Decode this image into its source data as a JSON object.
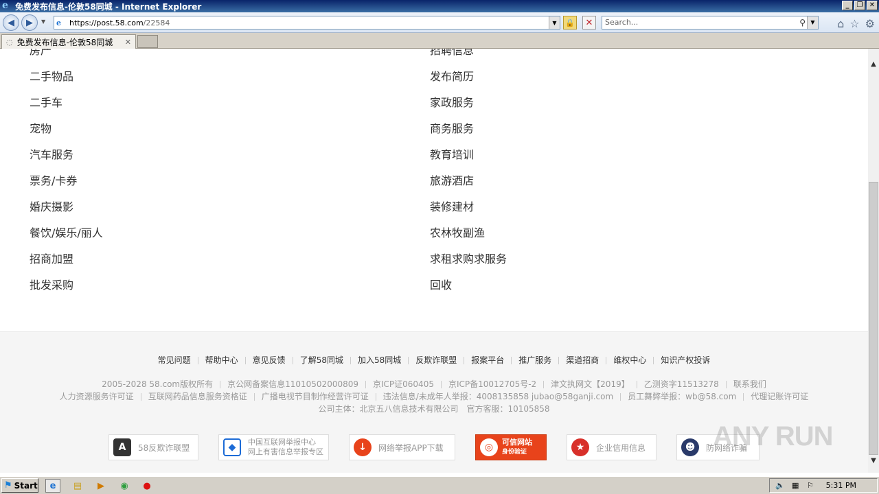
{
  "window": {
    "title": "免费发布信息-伦敦58同城 - Internet Explorer"
  },
  "address_bar": {
    "url_host": "https://post.58.com",
    "url_path": "/22584"
  },
  "search": {
    "placeholder": "Search..."
  },
  "tab": {
    "label": "免费发布信息-伦敦58同城"
  },
  "categories_left": [
    {
      "label": "房产"
    },
    {
      "label": "二手物品"
    },
    {
      "label": "二手车"
    },
    {
      "label": "宠物"
    },
    {
      "label": "汽车服务"
    },
    {
      "label": "票务/卡券"
    },
    {
      "label": "婚庆摄影"
    },
    {
      "label": "餐饮/娱乐/丽人"
    },
    {
      "label": "招商加盟"
    },
    {
      "label": "批发采购"
    }
  ],
  "categories_right": [
    {
      "label": "招聘信息"
    },
    {
      "label": "发布简历"
    },
    {
      "label": "家政服务"
    },
    {
      "label": "商务服务"
    },
    {
      "label": "教育培训"
    },
    {
      "label": "旅游酒店"
    },
    {
      "label": "装修建材"
    },
    {
      "label": "农林牧副渔"
    },
    {
      "label": "求租求购求服务"
    },
    {
      "label": "回收"
    }
  ],
  "footer": {
    "links": [
      "常见问题",
      "帮助中心",
      "意见反馈",
      "了解58同城",
      "加入58同城",
      "反欺诈联盟",
      "报案平台",
      "推广服务",
      "渠道招商",
      "维权中心",
      "知识产权投诉"
    ],
    "line1": [
      "2005-2028 58.com版权所有",
      "京公网备案信息11010502000809",
      "京ICP证060405",
      "京ICP备10012705号-2",
      "津文执网文【2019】",
      "乙测资字11513278",
      "联系我们"
    ],
    "line2": [
      "人力资源服务许可证",
      "互联网药品信息服务资格证",
      "广播电视节目制作经营许可证",
      "违法信息/未成年人举报：4008135858 jubao@58ganji.com",
      "员工舞弊举报：wb@58.com",
      "代理记账许可证"
    ],
    "line3": "公司主体：北京五八信息技术有限公司　官方客服：10105858",
    "badges": {
      "antifraud": "58反欺诈联盟",
      "cn_report_1": "中国互联网举报中心",
      "cn_report_2": "网上有害信息举报专区",
      "app_report": "网络举报APP下载",
      "trusted_1": "可信网站",
      "trusted_2": "身份验证",
      "credit": "企业信用信息",
      "anti_scam": "防网络诈骗"
    }
  },
  "taskbar": {
    "start_label": "Start",
    "clock": "5:31 PM"
  },
  "watermark": "ANY RUN",
  "colors": {
    "title_bar": "#0a246a",
    "trusted_badge": "#e8431b",
    "page_text": "#333333"
  }
}
